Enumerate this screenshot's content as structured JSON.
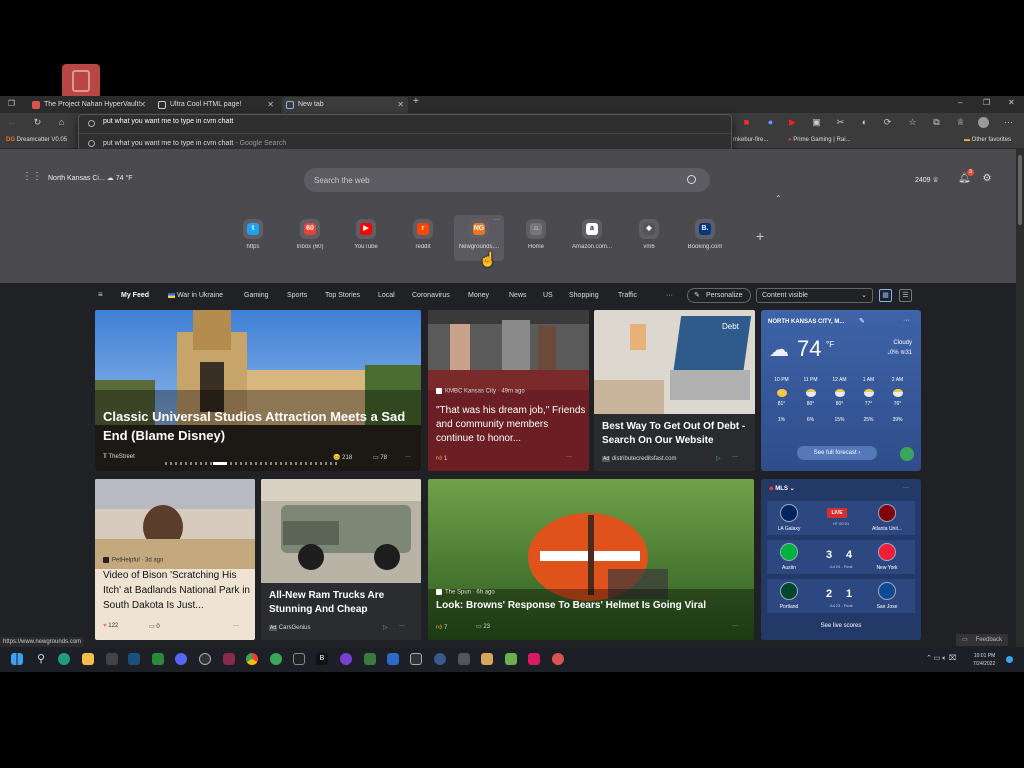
{
  "tabs": [
    {
      "title": "The Project Nahan HyperVault!",
      "icon_color": "#d9544f"
    },
    {
      "title": "Ultra Cool HTML page!",
      "icon_color": "#cccccc"
    },
    {
      "title": "New tab",
      "icon_color": "#8ab4f8"
    }
  ],
  "address_bar": {
    "value": "put what you want me to type in cvm chatt",
    "suggestion": "put what you want me to type in cvm chatt",
    "suggestion_sub": " - Google Search"
  },
  "favorites": {
    "left": "Dreamcatter V0.05",
    "mid": "mkebur-fire...",
    "right_item": "Prime Gaming | Rai...",
    "other": "Other favorites"
  },
  "header": {
    "location": "North Kansas Ci...",
    "temp": "74 °F",
    "search_placeholder": "Search the web",
    "points": "2409",
    "notif_count": "3"
  },
  "quick_links": [
    {
      "label": "https",
      "icon": "twitter-icon",
      "color": "#1da1f2",
      "glyph": "t"
    },
    {
      "label": "Inbox (60)",
      "icon": "gmail-icon",
      "color": "#ea4335",
      "glyph": "60"
    },
    {
      "label": "YouTube",
      "icon": "youtube-icon",
      "color": "#ff0000",
      "glyph": "▶"
    },
    {
      "label": "reddit",
      "icon": "reddit-icon",
      "color": "#ff4500",
      "glyph": "r"
    },
    {
      "label": "Newgrounds....",
      "icon": "newgrounds-icon",
      "color": "#e87722",
      "glyph": "NG"
    },
    {
      "label": "Home",
      "icon": "home-icon",
      "color": "#777777",
      "glyph": "⌂"
    },
    {
      "label": "Amazon.com...",
      "icon": "amazon-icon",
      "color": "#ffffff",
      "glyph": "a"
    },
    {
      "label": "vm6",
      "icon": "vm-icon",
      "color": "#555555",
      "glyph": "◆"
    },
    {
      "label": "Booking.com",
      "icon": "booking-icon",
      "color": "#003580",
      "glyph": "B."
    }
  ],
  "feed_nav": {
    "items": [
      "My Feed",
      "War in Ukraine",
      "Gaming",
      "Sports",
      "Top Stories",
      "Local",
      "Coronavirus",
      "Money",
      "News",
      "US",
      "Shopping",
      "Traffic"
    ],
    "more": "···",
    "personalize": "Personalize",
    "content_select": "Content visible"
  },
  "cards": {
    "universal": {
      "title": "Classic Universal Studios Attraction Meets a Sad End (Blame Disney)",
      "source": "TheStreet",
      "reactions": "218",
      "comments": "78"
    },
    "gym": {
      "source": "KMBC Kansas City · 49m ago",
      "title": "\"That was his dream job,\" Friends and community members continue to honor...",
      "reactions": "1"
    },
    "debt": {
      "title": "Best Way To Get Out Of Debt - Search On Our Website",
      "source": "distributecreditsfast.com",
      "screen_text": "Debt"
    },
    "bison": {
      "source": "PetHelpful · 3d ago",
      "title": "Video of Bison 'Scratching His Itch' at Badlands National Park in South Dakota Is Just...",
      "reactions": "122",
      "comments": "0"
    },
    "ram": {
      "title": "All-New Ram Trucks Are Stunning And Cheap",
      "source": "CarsGenius"
    },
    "browns": {
      "source": "The Spun · 6h ago",
      "title": "Look: Browns' Response To Bears' Helmet Is Going Viral",
      "reactions": "7",
      "comments": "23"
    }
  },
  "weather": {
    "location": "NORTH KANSAS CITY, M...",
    "temp": "74",
    "unit": "°F",
    "condition": "Cloudy",
    "precip": "0%",
    "wind": "31",
    "hourly": [
      {
        "time": "10 PM",
        "temp": "81°",
        "precip": "1%"
      },
      {
        "time": "11 PM",
        "temp": "80°",
        "precip": "6%"
      },
      {
        "time": "12 AM",
        "temp": "80°",
        "precip": "15%"
      },
      {
        "time": "1 AM",
        "temp": "77°",
        "precip": "25%"
      },
      {
        "time": "2 AM",
        "temp": "76°",
        "precip": "39%"
      }
    ],
    "forecast_link": "See full forecast ›"
  },
  "mls": {
    "league": "MLS",
    "matches": [
      {
        "home": "LA Galaxy",
        "away": "Atlanta Unit...",
        "status": "LIVE",
        "detail": "HT 00:01",
        "home_score": "",
        "away_score": "",
        "home_color": "#00245d",
        "away_color": "#80000a"
      },
      {
        "home": "Austin",
        "away": "New York",
        "status": "",
        "detail": "Jul 24 - Final",
        "home_score": "3",
        "away_score": "4",
        "home_color": "#00b140",
        "away_color": "#ed1e36"
      },
      {
        "home": "Portland",
        "away": "San Jose",
        "status": "",
        "detail": "Jul 23 - Final",
        "home_score": "2",
        "away_score": "1",
        "home_color": "#00482b",
        "away_color": "#0d4c92"
      }
    ],
    "scores_link": "See live scores"
  },
  "status_url": "https://www.newgrounds.com",
  "feedback": "Feedback",
  "clock": {
    "time": "10:01 PM",
    "date": "7/24/2022"
  }
}
